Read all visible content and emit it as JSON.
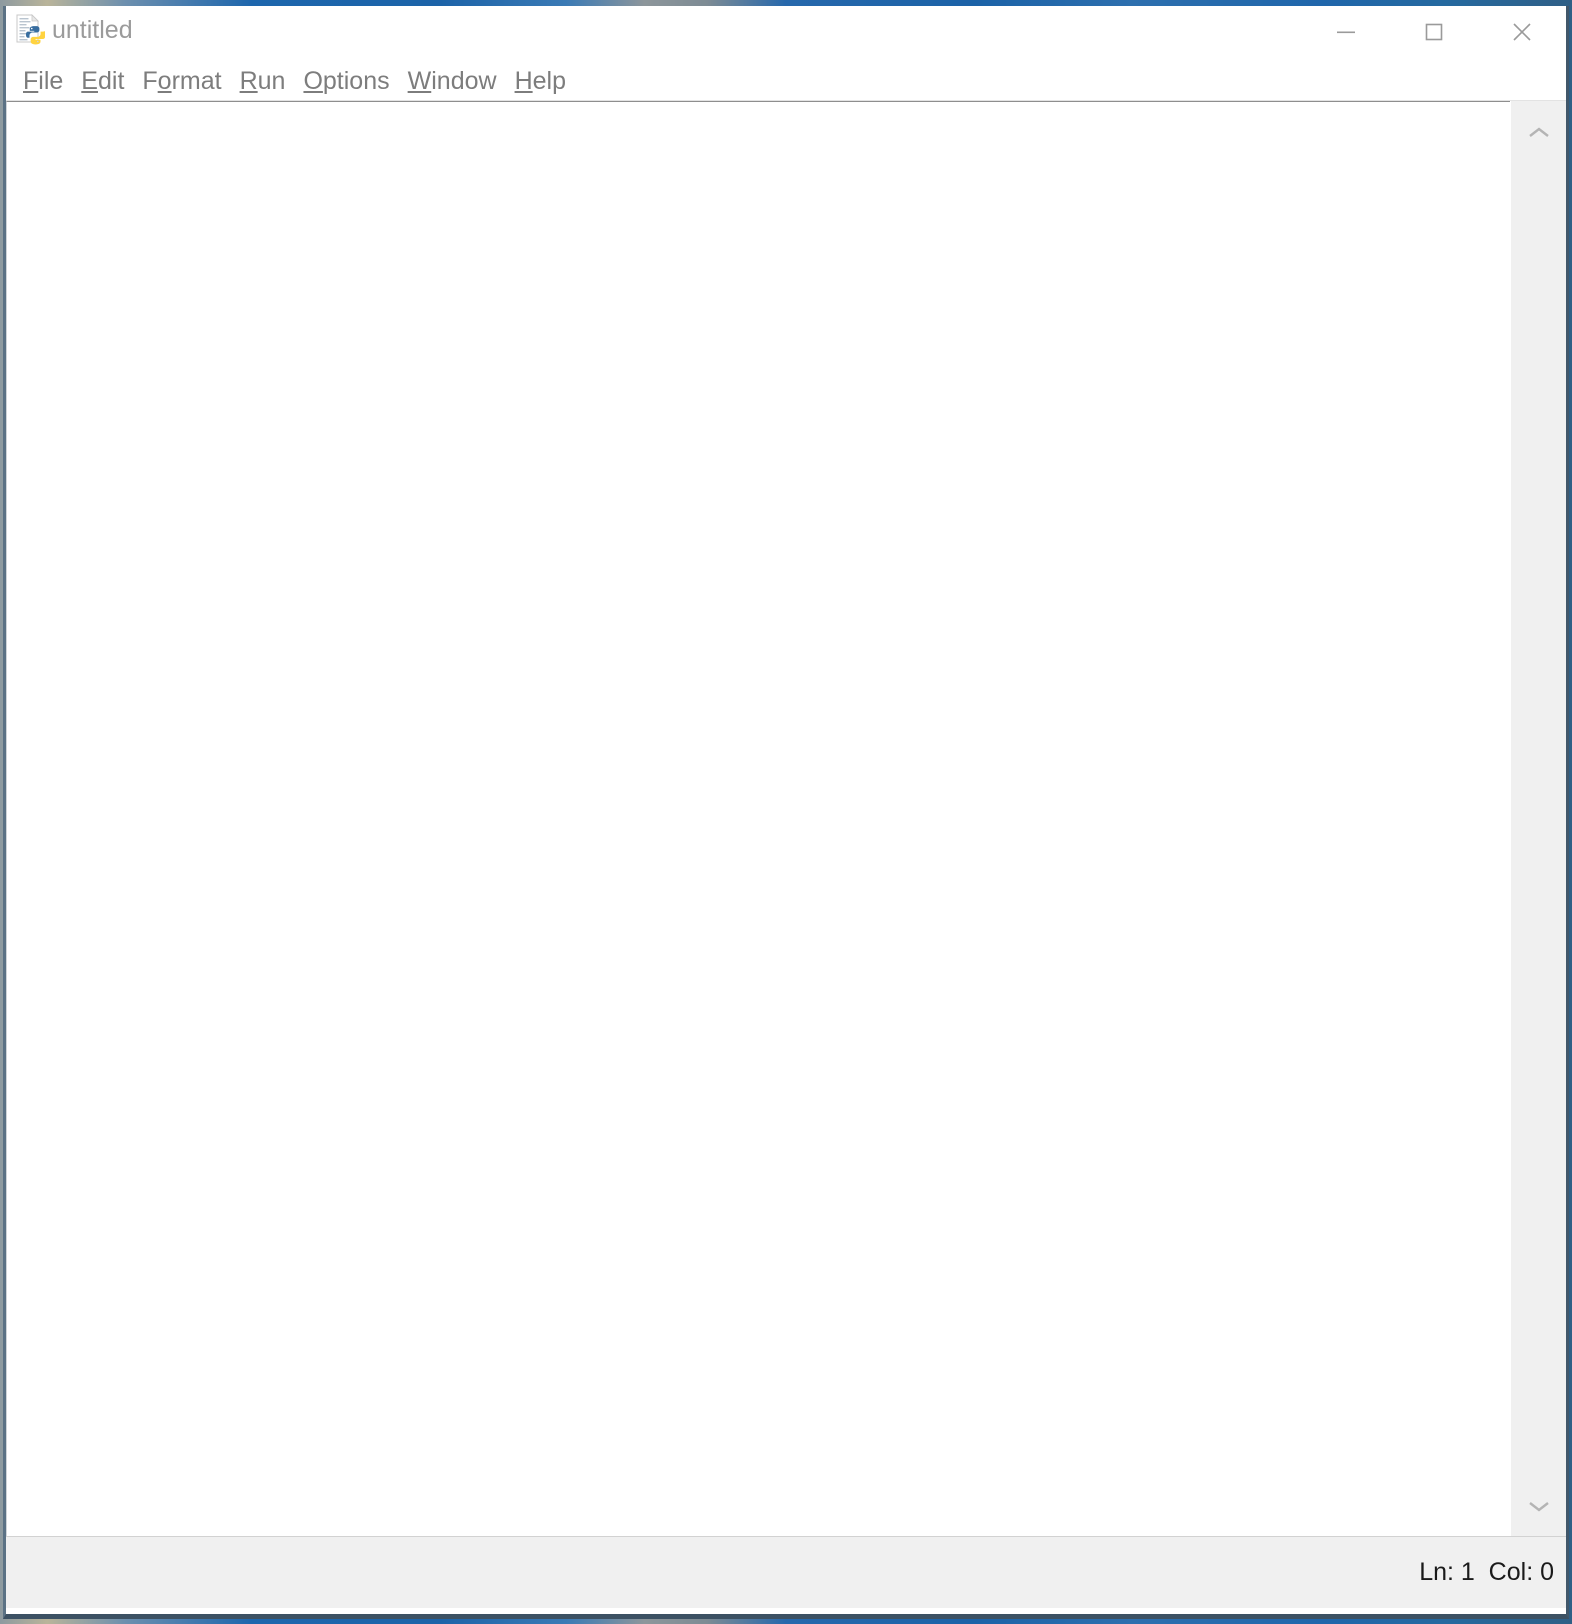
{
  "window": {
    "title": "untitled",
    "icon": "python-file-icon",
    "controls": [
      {
        "name": "minimize-button",
        "glyph": "minimize-icon",
        "label": "Minimize"
      },
      {
        "name": "maximize-button",
        "glyph": "maximize-icon",
        "label": "Maximize"
      },
      {
        "name": "close-button",
        "glyph": "close-icon",
        "label": "Close"
      }
    ]
  },
  "menubar": {
    "items": [
      {
        "label": "File",
        "mnemonic": "F",
        "rest": "ile"
      },
      {
        "label": "Edit",
        "mnemonic": "E",
        "rest": "dit"
      },
      {
        "label": "Format",
        "mnemonic": "F",
        "rest": "ormat",
        "mn_index": 1
      },
      {
        "label": "Run",
        "mnemonic": "R",
        "rest": "un"
      },
      {
        "label": "Options",
        "mnemonic": "O",
        "rest": "ptions"
      },
      {
        "label": "Window",
        "mnemonic": "W",
        "rest": "indow"
      },
      {
        "label": "Help",
        "mnemonic": "H",
        "rest": "elp"
      }
    ],
    "file_pre": "",
    "file_mn": "F",
    "file_post": "ile",
    "edit_pre": "",
    "edit_mn": "E",
    "edit_post": "dit",
    "format_pre": "F",
    "format_mn": "o",
    "format_post": "rmat",
    "run_pre": "",
    "run_mn": "R",
    "run_post": "un",
    "options_pre": "",
    "options_mn": "O",
    "options_post": "ptions",
    "window_pre": "",
    "window_mn": "W",
    "window_post": "indow",
    "help_pre": "",
    "help_mn": "H",
    "help_post": "elp"
  },
  "editor": {
    "content": "",
    "scrollbar": {
      "up_arrow": "chevron-up-icon",
      "down_arrow": "chevron-down-icon"
    }
  },
  "statusbar": {
    "position": "Ln: 1  Col: 0",
    "line": "1",
    "column": "0"
  },
  "colors": {
    "title_text": "#9b9b9b",
    "menu_text": "#7d7d7d",
    "status_bg": "#f0f0f0",
    "scrollbar_bg": "#f0f0f0",
    "window_border": "#41576a",
    "desktop": "#1d66ad",
    "python_blue": "#386d9f",
    "python_yellow": "#ffd33f"
  }
}
